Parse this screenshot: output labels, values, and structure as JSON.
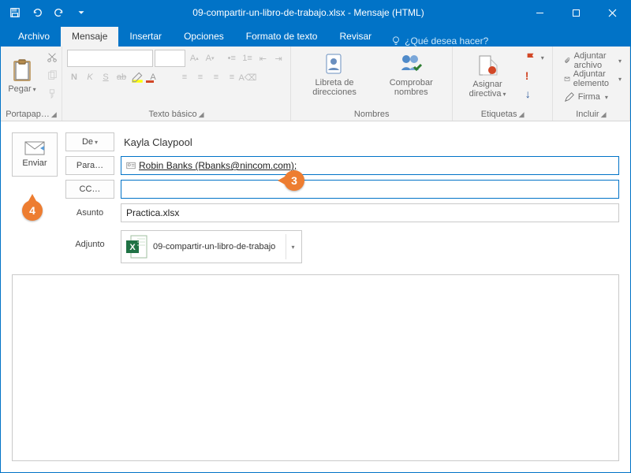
{
  "title": "09-compartir-un-libro-de-trabajo.xlsx  -  Mensaje (HTML)",
  "tabs": {
    "archivo": "Archivo",
    "mensaje": "Mensaje",
    "insertar": "Insertar",
    "opciones": "Opciones",
    "formato": "Formato de texto",
    "revisar": "Revisar",
    "tell": "¿Qué desea hacer?"
  },
  "ribbon": {
    "pegar": "Pegar",
    "portapapeles": "Portapap…",
    "texto_basico": "Texto básico",
    "n": "N",
    "k": "K",
    "s": "S",
    "libreta": "Libreta de direcciones",
    "comprobar": "Comprobar nombres",
    "nombres": "Nombres",
    "asignar": "Asignar directiva",
    "etiquetas": "Etiquetas",
    "adjuntar_archivo": "Adjuntar archivo",
    "adjuntar_elemento": "Adjuntar elemento",
    "firma": "Firma",
    "incluir": "Incluir"
  },
  "compose": {
    "enviar": "Enviar",
    "de": "De",
    "de_val": "Kayla Claypool",
    "para": "Para…",
    "para_val": "Robin Banks (Rbanks@nincom.com);",
    "cc": "CC…",
    "asunto_lbl": "Asunto",
    "asunto_val": "Practica.xlsx",
    "adjunto_lbl": "Adjunto",
    "adjunto_name": "09-compartir-un-libro-de-trabajo"
  },
  "callouts": {
    "c3": "3",
    "c4": "4"
  }
}
